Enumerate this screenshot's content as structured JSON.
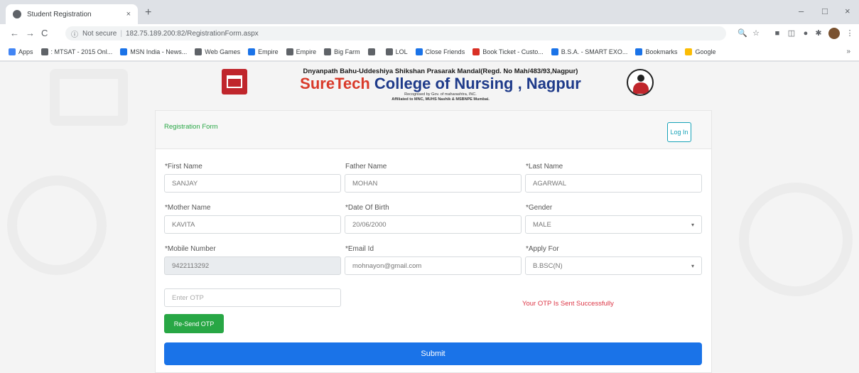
{
  "browser": {
    "tab_title": "Student Registration",
    "tab_close": "×",
    "new_tab": "+",
    "window_controls": {
      "minimize": "–",
      "maximize": "□",
      "close": "×"
    },
    "nav": {
      "back": "←",
      "forward": "→",
      "reload": "C"
    },
    "security_label": "Not secure",
    "url_host": "182.75.189.200",
    "url_path": ":82/RegistrationForm.aspx",
    "bookmarks": [
      {
        "label": "Apps",
        "color": "#4285f4"
      },
      {
        "label": ": MTSAT - 2015 Onl...",
        "color": "#5f6368"
      },
      {
        "label": "MSN India - News...",
        "color": "#1a73e8"
      },
      {
        "label": "Web Games",
        "color": "#5f6368"
      },
      {
        "label": "Empire",
        "color": "#1a73e8"
      },
      {
        "label": "Empire",
        "color": "#5f6368"
      },
      {
        "label": "Big Farm",
        "color": "#5f6368"
      },
      {
        "label": "",
        "color": "#5f6368"
      },
      {
        "label": "LOL",
        "color": "#5f6368"
      },
      {
        "label": "Close Friends",
        "color": "#1a73e8"
      },
      {
        "label": "Book Ticket - Custo...",
        "color": "#d93025"
      },
      {
        "label": "B.S.A. - SMART EXO...",
        "color": "#1a73e8"
      },
      {
        "label": "Bookmarks",
        "color": "#1a73e8"
      },
      {
        "label": "Google",
        "color": "#fbbc04"
      }
    ],
    "bookmarks_more": "»"
  },
  "header": {
    "mandal": "Dnyanpath Bahu-Uddeshiya Shikshan Prasarak Mandal(Regd. No Mah/483/93,Nagpur)",
    "college_brand": "SureTech",
    "college_rest": " College of Nursing , Nagpur",
    "recognition": "Recognised by Gov. of maharashtra, INC.",
    "affiliation": "Affiliated to MNC, MUHS Nashik & MSBNPE Mumbai."
  },
  "form": {
    "title": "Registration Form",
    "login_label": "Log In",
    "first_name": {
      "label": "*First Name",
      "value": "SANJAY"
    },
    "father_name": {
      "label": "Father Name",
      "value": "MOHAN"
    },
    "last_name": {
      "label": "*Last Name",
      "value": "AGARWAL"
    },
    "mother_name": {
      "label": "*Mother Name",
      "value": "KAVITA"
    },
    "dob": {
      "label": "*Date Of Birth",
      "value": "20/06/2000"
    },
    "gender": {
      "label": "*Gender",
      "value": "MALE"
    },
    "mobile": {
      "label": "*Mobile Number",
      "value": "9422113292"
    },
    "email": {
      "label": "*Email Id",
      "value": "mohnayon@gmail.com"
    },
    "apply_for": {
      "label": "*Apply For",
      "value": "B.BSC(N)"
    },
    "otp": {
      "placeholder": "Enter OTP"
    },
    "otp_message": "Your OTP Is Sent Successfully",
    "resend_label": "Re-Send OTP",
    "submit_label": "Submit",
    "select_arrow": "▾"
  }
}
